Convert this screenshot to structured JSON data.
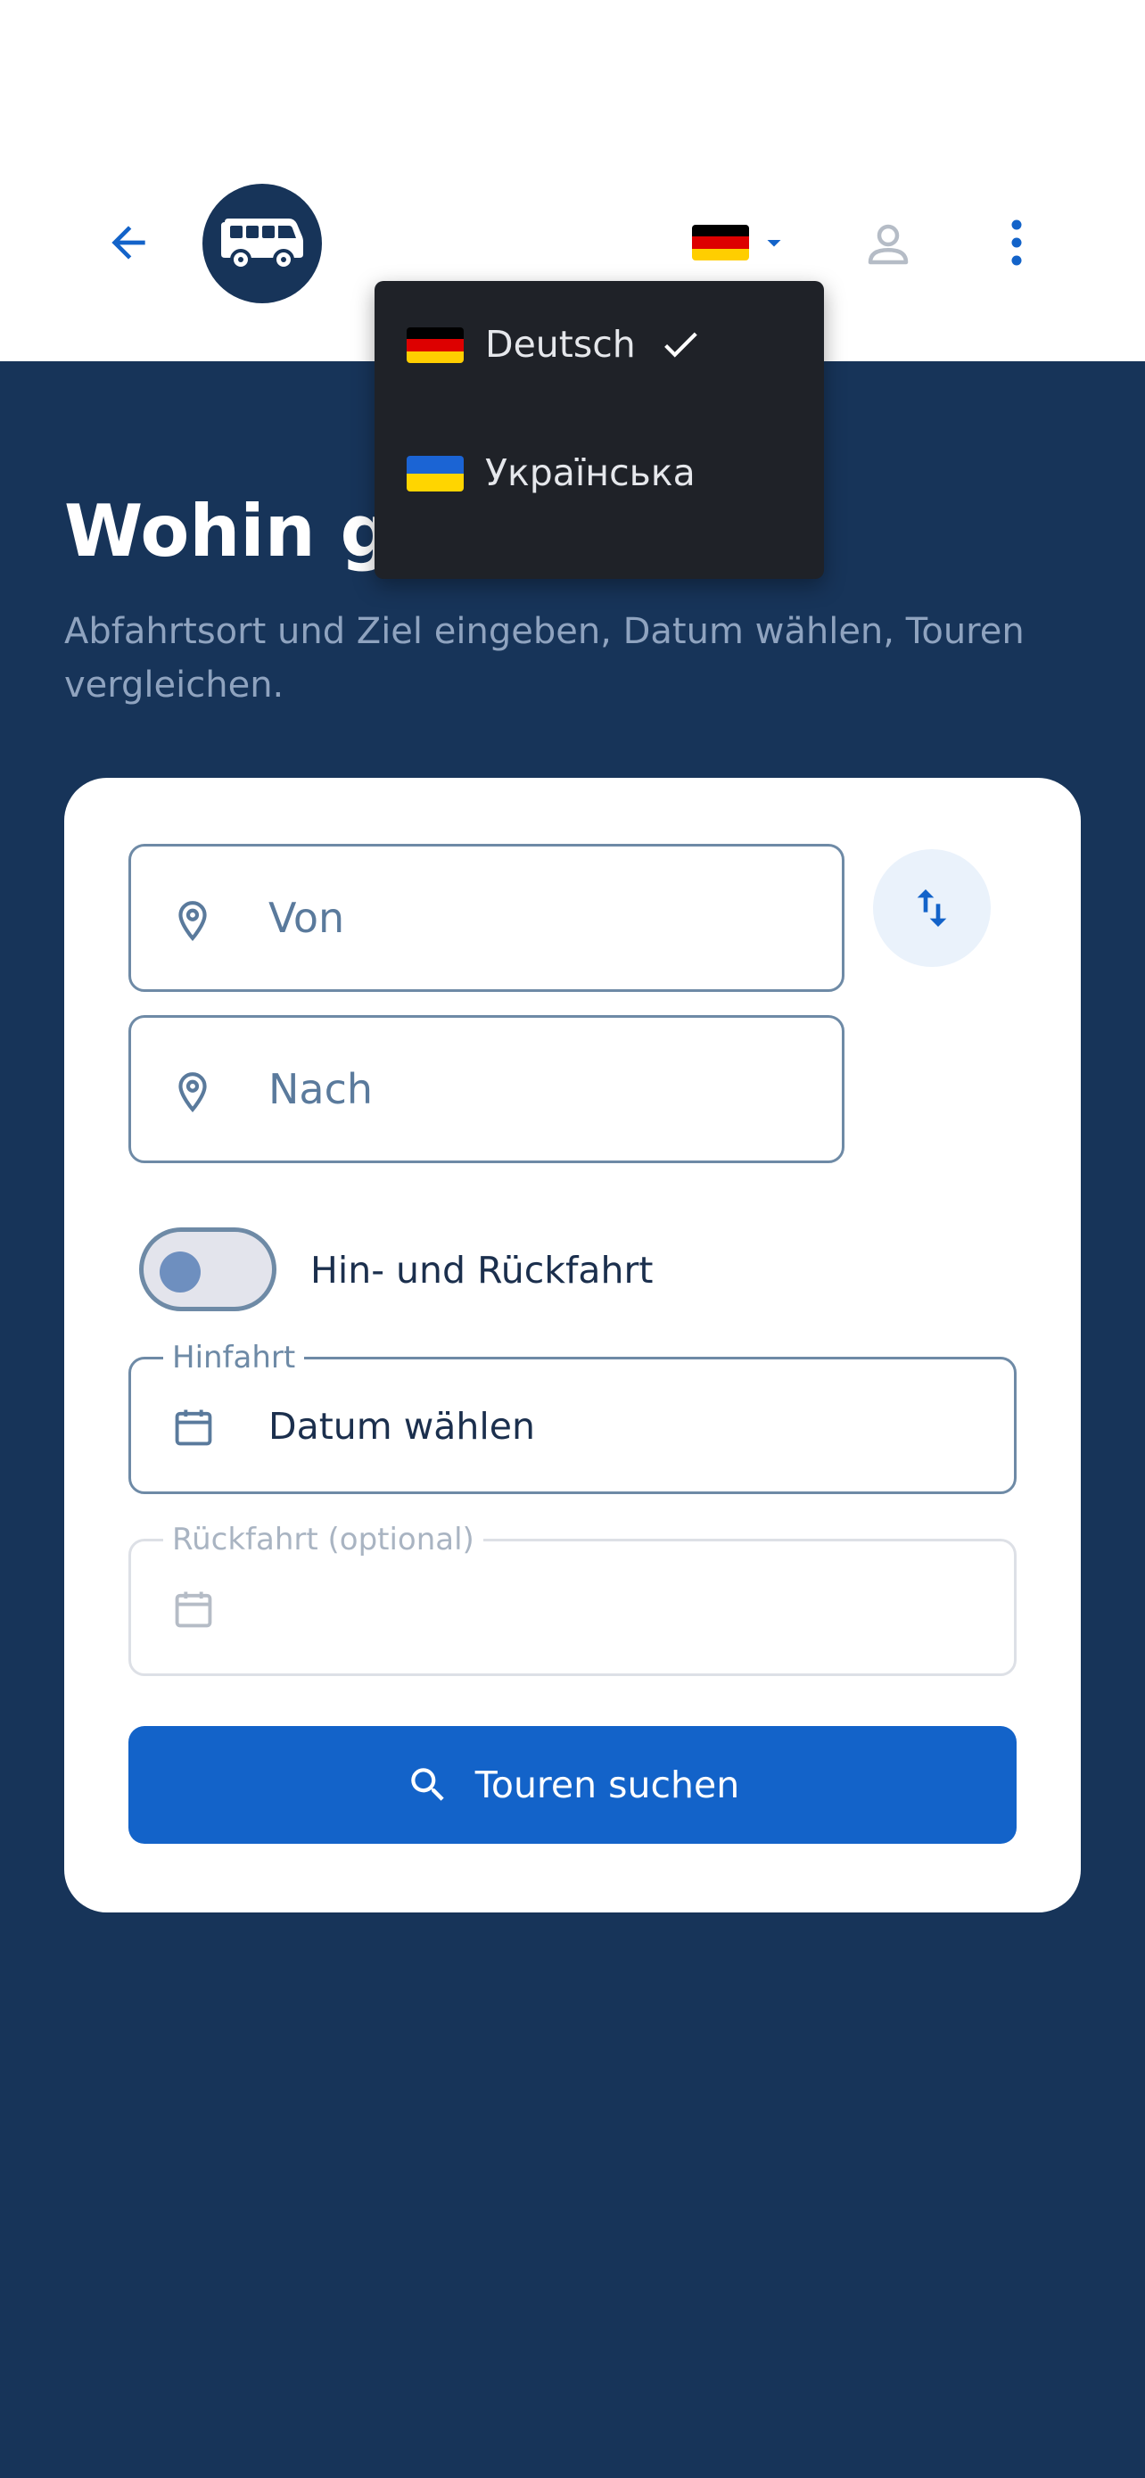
{
  "header": {
    "back_icon": "arrow-left-icon",
    "logo_icon": "bus-icon",
    "language_selected_flag": "de",
    "user_icon": "user-icon",
    "more_icon": "more-vertical-icon"
  },
  "language_menu": {
    "items": [
      {
        "label": "Deutsch",
        "flag": "de",
        "selected": true
      },
      {
        "label": "Українська",
        "flag": "ua",
        "selected": false
      }
    ]
  },
  "hero": {
    "title": "Wohin geht's?",
    "subtitle": "Abfahrtsort und Ziel eingeben, Datum wählen, Touren vergleichen."
  },
  "search_form": {
    "from_placeholder": "Von",
    "to_placeholder": "Nach",
    "swap_icon": "swap-vertical-icon",
    "round_trip_label": "Hin- und Rückfahrt",
    "round_trip_enabled": false,
    "outbound_label": "Hinfahrt",
    "outbound_value": "Datum wählen",
    "return_label": "Rückfahrt (optional)",
    "return_value": "",
    "submit_label": "Touren suchen"
  },
  "colors": {
    "primary": "#1363c9",
    "navy": "#173459",
    "menu_bg": "#1f2228",
    "border": "#6e8aa6"
  }
}
